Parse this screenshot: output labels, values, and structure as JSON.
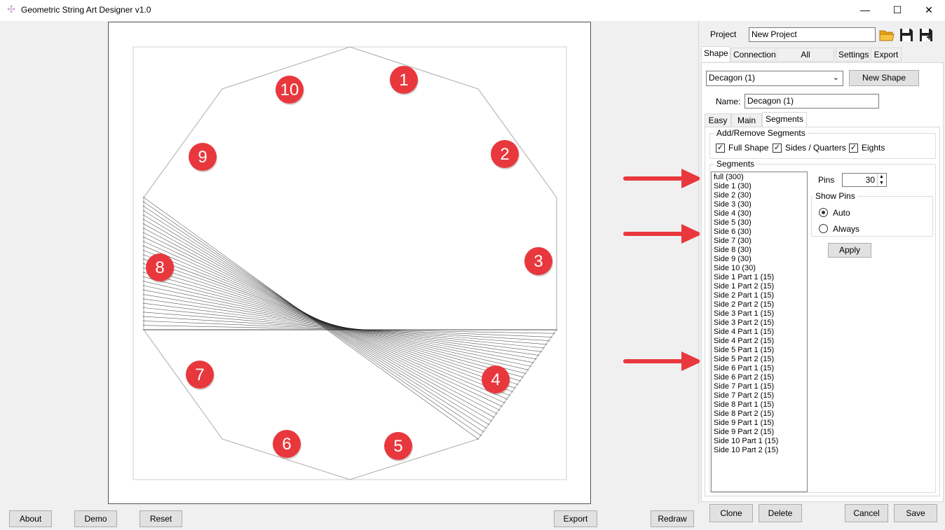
{
  "window": {
    "title": "Geometric String Art Designer v1.0",
    "icon": "app-star-icon",
    "minimize_icon": "—",
    "maximize_icon": "☐",
    "close_icon": "✕"
  },
  "bottom_bar": {
    "about_label": "About",
    "demo_label": "Demo",
    "reset_label": "Reset",
    "export_label": "Export",
    "redraw_label": "Redraw"
  },
  "side_markers": [
    "1",
    "2",
    "3",
    "4",
    "5",
    "6",
    "7",
    "8",
    "9",
    "10"
  ],
  "panel": {
    "project_label": "Project",
    "project_value": "New Project",
    "open_icon": "folder-open-icon",
    "save_icon": "save-icon",
    "save_as_icon": "save-as-icon",
    "tabs": [
      "Shape",
      "Connection",
      "All Connections",
      "Settings",
      "Export"
    ],
    "active_tab": "Shape",
    "shape_select_value": "Decagon (1)",
    "new_shape_label": "New Shape",
    "name_label": "Name:",
    "name_value": "Decagon (1)",
    "subtabs": [
      "Easy",
      "Main",
      "Segments"
    ],
    "active_subtab": "Segments",
    "add_remove_title": "Add/Remove Segments",
    "checkboxes": [
      {
        "label": "Full Shape",
        "checked": true
      },
      {
        "label": "Sides / Quarters",
        "checked": true
      },
      {
        "label": "Eights",
        "checked": true
      }
    ],
    "segments_title": "Segments",
    "segments": [
      "full (300)",
      "Side 1 (30)",
      "Side 2 (30)",
      "Side 3 (30)",
      "Side 4 (30)",
      "Side 5 (30)",
      "Side 6 (30)",
      "Side 7 (30)",
      "Side 8 (30)",
      "Side 9 (30)",
      "Side 10 (30)",
      "Side 1 Part 1 (15)",
      "Side 1 Part 2 (15)",
      "Side 2 Part 1 (15)",
      "Side 2 Part 2 (15)",
      "Side 3 Part 1 (15)",
      "Side 3 Part 2 (15)",
      "Side 4 Part 1 (15)",
      "Side 4 Part 2 (15)",
      "Side 5 Part 1 (15)",
      "Side 5 Part 2 (15)",
      "Side 6 Part 1 (15)",
      "Side 6 Part 2 (15)",
      "Side 7 Part 1 (15)",
      "Side 7 Part 2 (15)",
      "Side 8 Part 1 (15)",
      "Side 8 Part 2 (15)",
      "Side 9 Part 1 (15)",
      "Side 9 Part 2 (15)",
      "Side 10 Part 1 (15)",
      "Side 10 Part 2 (15)"
    ],
    "pins_label": "Pins",
    "pins_value": "30",
    "show_pins_title": "Show Pins",
    "radio_auto": "Auto",
    "radio_always": "Always",
    "show_pins_selected": "Auto",
    "apply_label": "Apply",
    "clone_label": "Clone",
    "delete_label": "Delete",
    "cancel_label": "Cancel",
    "save_label": "Save"
  },
  "colors": {
    "marker_fill": "#e8383d",
    "arrow": "#e8383d",
    "outline": "#aaaaaa",
    "string": "#222222"
  }
}
